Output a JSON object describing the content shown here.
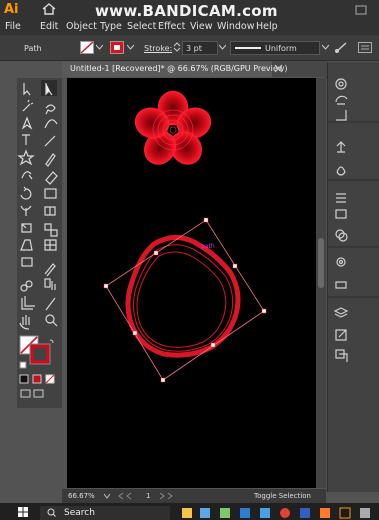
{
  "app": {
    "logo": "Ai"
  },
  "watermark": "www.BANDICAM.com",
  "menu": [
    "File",
    "Edit",
    "Object",
    "Type",
    "Select",
    "Effect",
    "View",
    "Window",
    "Help"
  ],
  "control": {
    "selection_type": "Path",
    "stroke_label": "Stroke:",
    "stroke_value": "3 pt",
    "profile_label": "Uniform"
  },
  "document": {
    "tab_title": "Untitled-1 [Recovered]* @ 66.67% (RGB/GPU Preview)"
  },
  "canvas": {
    "anchor_hint": "path"
  },
  "status": {
    "zoom": "66.67%",
    "artboard_number": "1",
    "tool_hint": "Toggle Selection"
  },
  "taskbar": {
    "search_label": "Search"
  },
  "colors": {
    "accent_red": "#e0101e",
    "bbox_pink": "#ff6f7f",
    "logo_orange": "#ff9a00"
  }
}
